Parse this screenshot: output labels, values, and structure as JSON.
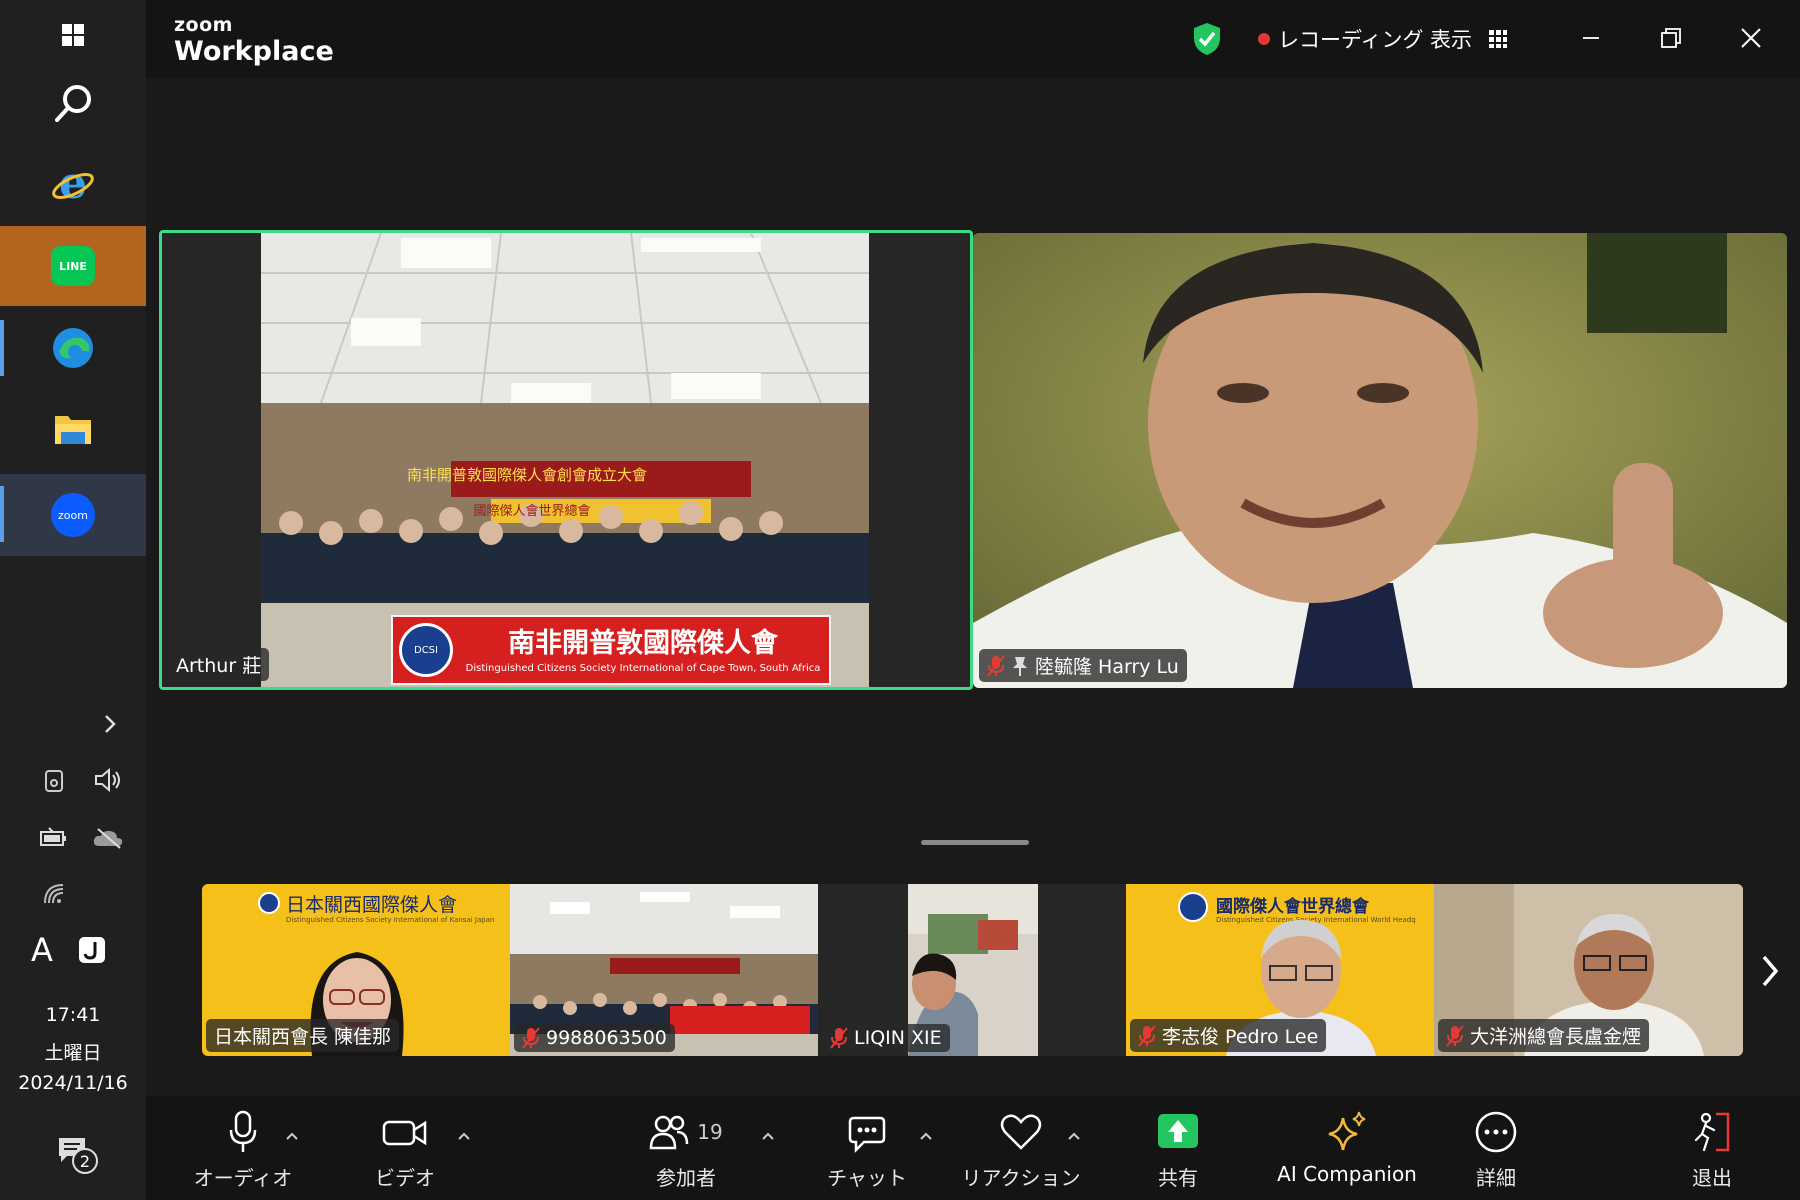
{
  "taskbar": {
    "time": "17:41",
    "weekday": "土曜日",
    "date": "2024/11/16",
    "ime_mode": "A",
    "notification_count": "2",
    "zoom_icon_text": "zoom",
    "line_icon_text": "LINE"
  },
  "titlebar": {
    "brand_small": "zoom",
    "brand_big": "Workplace",
    "recording_label": "レコーディング",
    "view_label": "表示",
    "recording_color": "#e53935",
    "shield_color": "#22c55e"
  },
  "main_tiles": [
    {
      "name": "Arthur 莊",
      "muted": false,
      "active_speaker": true
    },
    {
      "name": "陸毓隆 Harry Lu",
      "muted": true,
      "pinned": true
    }
  ],
  "banner": {
    "top_line": "南非開普敦國際傑人會創會成立大會",
    "second_line": "國際傑人會世界總會",
    "main_line": "南非開普敦國際傑人會",
    "sub_line": "Distinguished Citizens Society International of Cape Town, South Africa",
    "logo": "DCSI"
  },
  "strip_tiles": [
    {
      "name": "日本關西會長 陳佳那",
      "muted": false,
      "header": "日本關西國際傑人會",
      "subheader": "Distinguished Citizens Society International of Kansai Japan"
    },
    {
      "name": "9988063500",
      "muted": true
    },
    {
      "name": "LIQIN XIE",
      "muted": true
    },
    {
      "name": "李志俊 Pedro Lee",
      "muted": true,
      "header": "國際傑人會世界總會",
      "subheader": "Distinguished Citizens Society International World Headquarters"
    },
    {
      "name": "大洋洲總會長盧金煙",
      "muted": true
    }
  ],
  "toolbar": {
    "audio": "オーディオ",
    "video": "ビデオ",
    "participants": "参加者",
    "participants_count": "19",
    "chat": "チャット",
    "reactions": "リアクション",
    "share": "共有",
    "ai_companion": "AI Companion",
    "more": "詳細",
    "leave": "退出",
    "share_color": "#22c55e",
    "ai_color": "#f5b83d",
    "leave_color": "#e53935"
  }
}
